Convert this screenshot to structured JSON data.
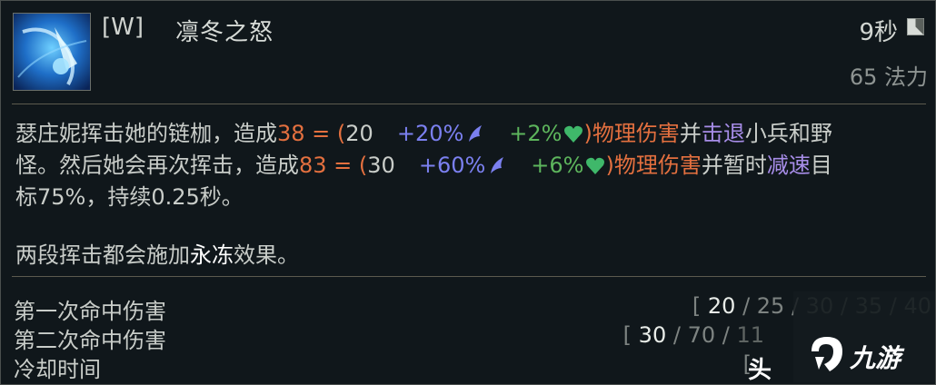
{
  "ability": {
    "key": "[W]",
    "name": "凛冬之怒",
    "cooldown": "9秒",
    "cost": "65 法力",
    "icon": "frost-flail-icon"
  },
  "description": {
    "line1": {
      "a": "瑟庄妮挥击她的链枷，造成",
      "dmg": "38 = (",
      "base": "20",
      "ap": "+20%",
      "hp": "+2%",
      "phys": ")物理伤害",
      "and": "并",
      "knock": "击退",
      "rest": "小兵和野"
    },
    "line2": {
      "a": "怪。然后她会再次挥击，造成",
      "dmg": "83 = (",
      "base": "30",
      "ap": "+60%",
      "hp": "+6%",
      "phys": ")物理伤害",
      "and": "并暂时",
      "slow": "减速",
      "rest": "目"
    },
    "line3": "标75%，持续0.25秒。",
    "para2_a": "两段挥击都会施加",
    "para2_frost": "永冻",
    "para2_b": "效果。"
  },
  "stats": [
    {
      "label": "第一次命中伤害",
      "open": "[ ",
      "cur": "20",
      "sep1": " / ",
      "v2": "25",
      "sep2": " / ",
      "v3": "30",
      "sep3": " / ",
      "v4": "35",
      "sep4": " / ",
      "v5": "40",
      "close": ""
    },
    {
      "label": "第二次命中伤害",
      "open": "[ ",
      "cur": "30",
      "sep1": " / ",
      "v2": "70",
      "sep2": " / ",
      "v3": "11",
      "sep3": "",
      "v4": "",
      "sep4": "",
      "v5": "",
      "close": ""
    },
    {
      "label": "冷却时间",
      "open": "[ ",
      "cur": "",
      "sep1": "",
      "v2": "",
      "sep2": "",
      "v3": "",
      "sep3": "",
      "v4": "",
      "sep4": "",
      "v5": "",
      "close": ""
    }
  ],
  "overlay": "头",
  "watermark": {
    "text": "九游",
    "icon": "jiuyou-logo-icon"
  },
  "colors": {
    "damage": "#e4703f",
    "ap": "#7b80f0",
    "hp": "#5db55c",
    "knockback": "#a78de8",
    "background": "#10171b"
  }
}
